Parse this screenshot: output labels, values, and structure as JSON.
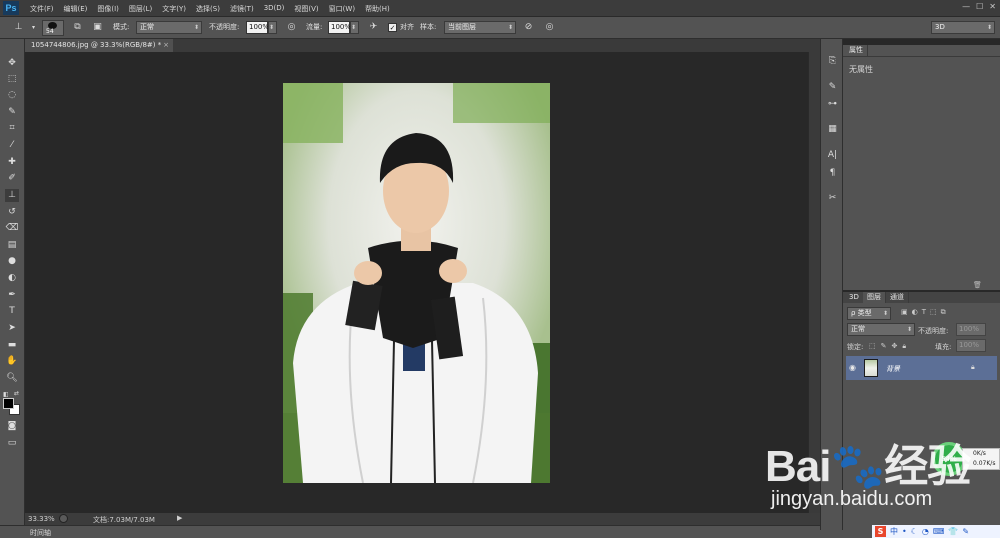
{
  "app": {
    "logo": "Ps"
  },
  "menu": {
    "items": [
      "文件(F)",
      "编辑(E)",
      "图像(I)",
      "图层(L)",
      "文字(Y)",
      "选择(S)",
      "滤镜(T)",
      "3D(D)",
      "视图(V)",
      "窗口(W)",
      "帮助(H)"
    ]
  },
  "window_buttons": [
    "—",
    "☐",
    "✕"
  ],
  "options": {
    "brush_size": "54",
    "mode_label": "模式:",
    "mode_value": "正常",
    "opacity_label": "不透明度:",
    "opacity_value": "100%",
    "flow_label": "流量:",
    "flow_value": "100%",
    "align_label": "对齐",
    "sample_label": "样本:",
    "sample_value": "当前图层",
    "workspace_value": "3D"
  },
  "document": {
    "tab_title": "1054744806.jpg @ 33.3%(RGB/8#) *"
  },
  "status": {
    "zoom": "33.33%",
    "doc_info": "文档:7.03M/7.03M"
  },
  "timeline": {
    "label": "时间轴"
  },
  "properties": {
    "tab": "属性",
    "empty_text": "无属性"
  },
  "layers_panel": {
    "tabs": [
      "3D",
      "图层",
      "通道"
    ],
    "filter_label": "ρ 类型",
    "blend_mode": "正常",
    "opacity_label": "不透明度:",
    "opacity_value": "100%",
    "lock_label": "锁定:",
    "fill_label": "填充:",
    "fill_value": "100%",
    "layer_name": "背景"
  },
  "net_monitor": {
    "percent": "54%",
    "up_speed": "0K/s",
    "down_speed": "0.07K/s"
  },
  "watermark": {
    "logo_text": "Bai🐾经验",
    "url": "jingyan.baidu.com"
  },
  "colors": {
    "panel": "#535353",
    "canvas": "#282828",
    "layer_selected": "#5c6f96",
    "ps_blue": "#4ab6f4"
  }
}
